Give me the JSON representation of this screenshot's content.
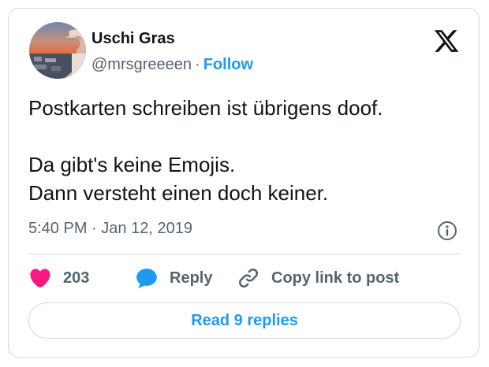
{
  "author": {
    "name": "Uschi Gras",
    "handle": "@mrsgreeeen",
    "separator": "·",
    "follow_label": "Follow"
  },
  "tweet": {
    "lines": [
      "Postkarten schreiben ist übrigens doof.",
      "Da gibt's keine Emojis.",
      "Dann versteht einen doch keiner."
    ],
    "time": "5:40 PM",
    "meta_separator": "·",
    "date": "Jan 12, 2019"
  },
  "actions": {
    "like_count": "203",
    "reply_label": "Reply",
    "copy_link_label": "Copy link to post"
  },
  "footer": {
    "read_replies_label": "Read 9 replies"
  },
  "icons": {
    "brand": "x-logo-icon",
    "info": "info-icon",
    "like": "heart-icon",
    "reply": "speech-bubble-icon",
    "copy": "link-icon"
  },
  "colors": {
    "accent": "#1d9bf0",
    "like": "#f91880",
    "text": "#0f1419",
    "muted": "#536471",
    "border": "#cfd9de"
  }
}
